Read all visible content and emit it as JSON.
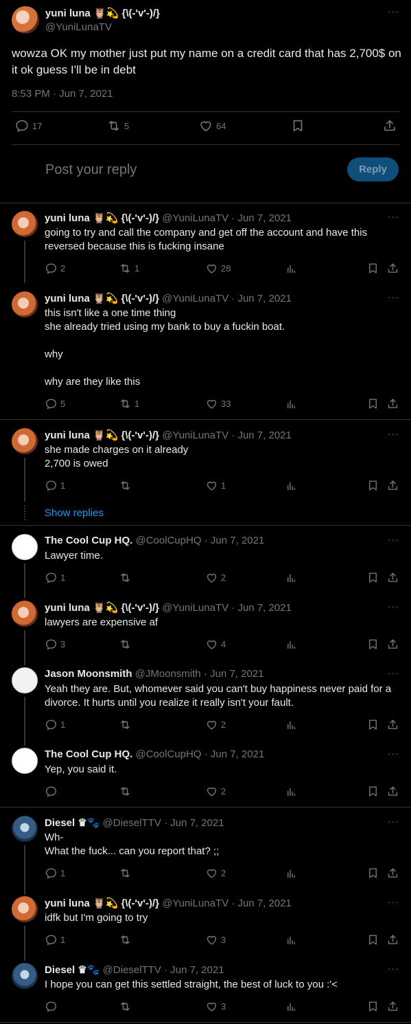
{
  "main": {
    "name": "yuni luna 🦉💫 {\\(-'v'-)/}",
    "handle": "@YuniLunaTV",
    "text": "wowza OK my mother just put my name on a credit card that has 2,700$ on it ok guess I'll be in debt",
    "time": "8:53 PM · Jun 7, 2021",
    "replies": "17",
    "retweets": "5",
    "likes": "64",
    "reply_placeholder": "Post your reply",
    "reply_button": "Reply",
    "more": "···"
  },
  "tweets": [
    {
      "name": "yuni luna 🦉💫 {\\(-'v'-)/}",
      "meta": "@YuniLunaTV · Jun 7, 2021",
      "lines": [
        "going to try and call the company and get off the account and have this",
        "reversed because this is fucking insane"
      ],
      "replies": "2",
      "retweets": "1",
      "likes": "28"
    },
    {
      "name": "yuni luna 🦉💫 {\\(-'v'-)/}",
      "meta": "@YuniLunaTV · Jun 7, 2021",
      "lines": [
        "this isn't like a one time thing",
        "she already tried using my bank to buy a fuckin boat.",
        "",
        "why",
        "",
        "why are they like this"
      ],
      "replies": "5",
      "retweets": "1",
      "likes": "33"
    },
    {
      "name": "yuni luna 🦉💫 {\\(-'v'-)/}",
      "meta": "@YuniLunaTV · Jun 7, 2021",
      "lines": [
        "she made charges on it already",
        "2,700 is owed"
      ],
      "replies": "1",
      "retweets": "",
      "likes": "1"
    },
    {
      "name": "The Cool Cup HQ.",
      "meta": "@CoolCupHQ · Jun 7, 2021",
      "lines": [
        "Lawyer time."
      ],
      "replies": "1",
      "retweets": "",
      "likes": "2"
    },
    {
      "name": "yuni luna 🦉💫 {\\(-'v'-)/}",
      "meta": "@YuniLunaTV · Jun 7, 2021",
      "lines": [
        "lawyers are expensive af"
      ],
      "replies": "3",
      "retweets": "",
      "likes": "4"
    },
    {
      "name": "Jason Moonsmith",
      "meta": "@JMoonsmith · Jun 7, 2021",
      "lines": [
        "Yeah they are. But, whomever said you can't buy happiness never paid for a",
        "divorce. It hurts until you realize it really isn't your fault."
      ],
      "replies": "1",
      "retweets": "",
      "likes": "2"
    },
    {
      "name": "The Cool Cup HQ.",
      "meta": "@CoolCupHQ · Jun 7, 2021",
      "lines": [
        "Yep, you said it."
      ],
      "replies": "",
      "retweets": "",
      "likes": "2"
    },
    {
      "name": "Diesel ♛🐾",
      "meta": "@DieselTTV · Jun 7, 2021",
      "lines": [
        "Wh-",
        "What the fuck... can you report that? ;;"
      ],
      "replies": "1",
      "retweets": "",
      "likes": "2"
    },
    {
      "name": "yuni luna 🦉💫 {\\(-'v'-)/}",
      "meta": "@YuniLunaTV · Jun 7, 2021",
      "lines": [
        "idfk but I'm going to try"
      ],
      "replies": "1",
      "retweets": "",
      "likes": "3"
    },
    {
      "name": "Diesel ♛🐾",
      "meta": "@DieselTTV · Jun 7, 2021",
      "lines": [
        "I hope you can get this settled straight, the best of luck to you :'<"
      ],
      "replies": "",
      "retweets": "",
      "likes": "3"
    }
  ],
  "show_replies": "Show replies",
  "icons": [
    "reply-icon",
    "retweet-icon",
    "like-icon",
    "views-icon",
    "bookmark-icon",
    "share-icon",
    "more-icon"
  ],
  "colors": {
    "background": "#000000",
    "text": "#e7e9ea",
    "muted": "#71767b",
    "accent": "#1d9bf0",
    "reply_button": "#0f4e78",
    "divider": "#2f3336"
  }
}
